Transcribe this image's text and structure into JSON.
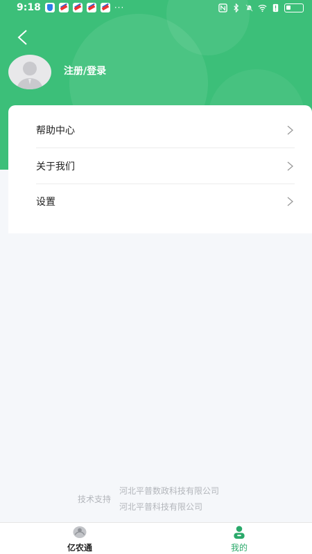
{
  "status_bar": {
    "time": "9:18",
    "more": "···"
  },
  "profile": {
    "login_label": "注册/登录"
  },
  "menu": {
    "items": [
      {
        "label": "帮助中心"
      },
      {
        "label": "关于我们"
      },
      {
        "label": "设置"
      }
    ]
  },
  "footer": {
    "support_label": "技术支持",
    "companies": [
      "河北平普数政科技有限公司",
      "河北平普科技有限公司"
    ]
  },
  "tabbar": {
    "tabs": [
      {
        "label": "亿农通"
      },
      {
        "label": "我的"
      }
    ]
  },
  "colors": {
    "header_green": "#3cbf79",
    "tab_active": "#2aa96a",
    "background": "#f5f7fa"
  },
  "icons": [
    "back-chevron-icon",
    "avatar-icon",
    "chevron-right-icon",
    "home-icon",
    "profile-icon"
  ]
}
